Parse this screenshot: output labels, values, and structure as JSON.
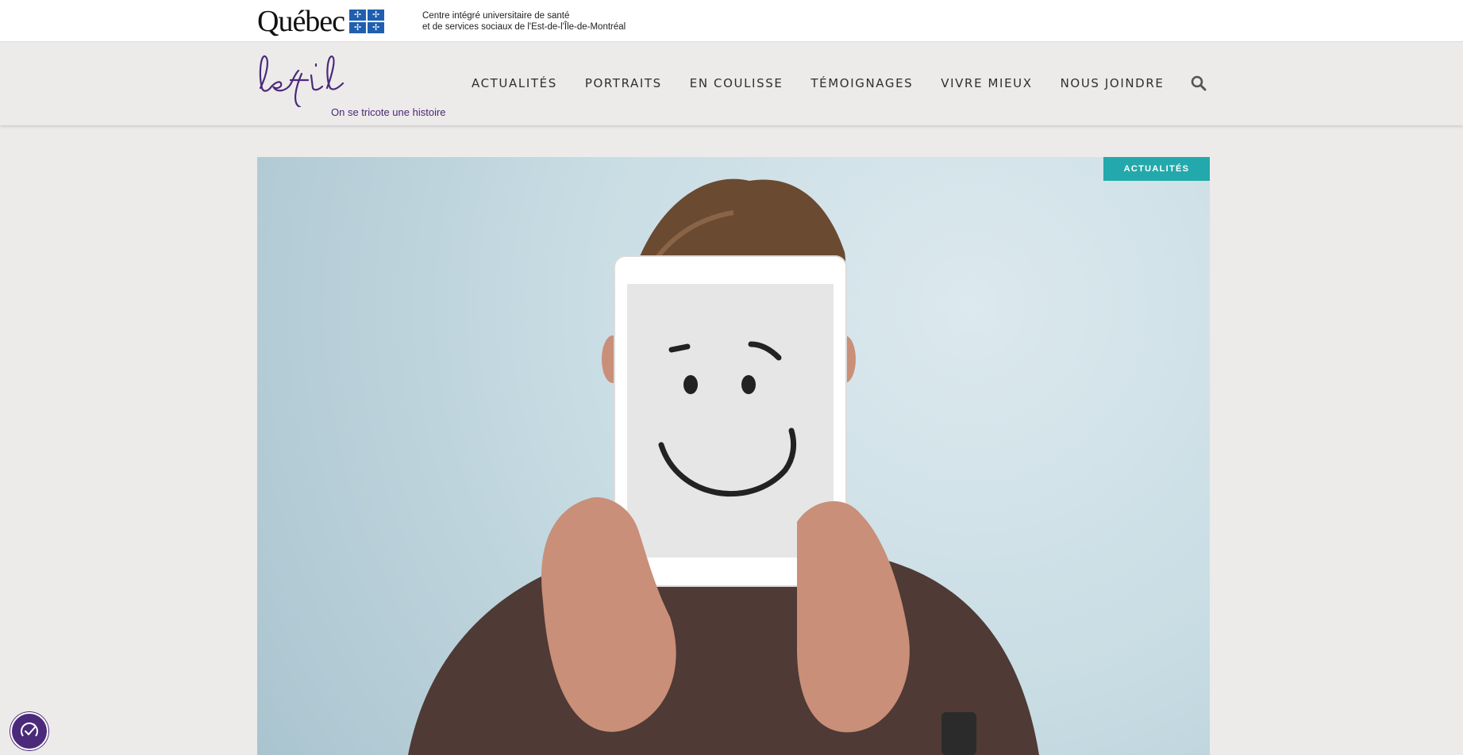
{
  "gov_bar": {
    "brand_word": "Québec",
    "institution_line1": "Centre intégré universitaire de santé",
    "institution_line2": "et de services sociaux de l'Est-de-l'Île-de-Montréal"
  },
  "header": {
    "logo_text": "le fil",
    "tagline": "On se tricote une histoire",
    "nav": [
      "ACTUALITÉS",
      "PORTRAITS",
      "EN COULISSE",
      "TÉMOIGNAGES",
      "VIVRE MIEUX",
      "NOUS JOINDRE"
    ],
    "search_icon": "search-icon"
  },
  "article": {
    "category": "ACTUALITÉS"
  },
  "colors": {
    "brand_purple": "#4b2a7b",
    "accent_teal": "#23a9ab",
    "header_bg": "#ecebea"
  },
  "widgets": {
    "accessibility_icon": "accessibility-icon"
  }
}
